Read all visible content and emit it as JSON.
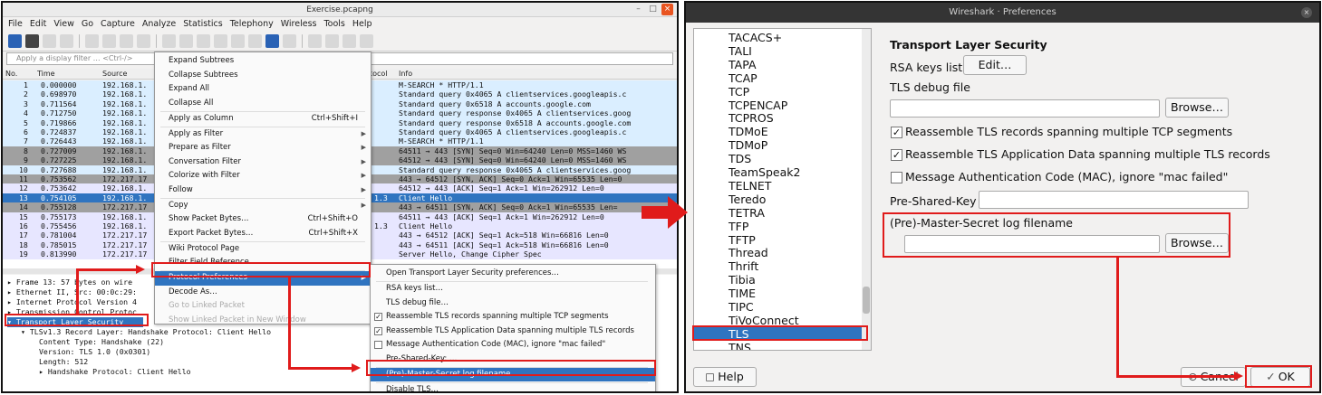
{
  "wireshark": {
    "title": "Exercise.pcapng",
    "menu": [
      "File",
      "Edit",
      "View",
      "Go",
      "Capture",
      "Analyze",
      "Statistics",
      "Telephony",
      "Wireless",
      "Tools",
      "Help"
    ],
    "filter_placeholder": "Apply a display filter … <Ctrl-/>",
    "columns": {
      "no": "No.",
      "time": "Time",
      "source": "Source",
      "protocol": "tocol",
      "info": "Info"
    },
    "packets": [
      {
        "no": "1",
        "time": "0.000000",
        "src": "192.168.1.",
        "proto": "",
        "info": "M-SEARCH * HTTP/1.1",
        "kind": "udp"
      },
      {
        "no": "2",
        "time": "0.698970",
        "src": "192.168.1.",
        "proto": "",
        "info": "Standard query 0x4065 A clientservices.googleapis.c",
        "kind": "udp"
      },
      {
        "no": "3",
        "time": "0.711564",
        "src": "192.168.1.",
        "proto": "",
        "info": "Standard query 0x6518 A accounts.google.com",
        "kind": "udp"
      },
      {
        "no": "4",
        "time": "0.712750",
        "src": "192.168.1.",
        "proto": "",
        "info": "Standard query response 0x4065 A clientservices.goog",
        "kind": "udp"
      },
      {
        "no": "5",
        "time": "0.719866",
        "src": "192.168.1.",
        "proto": "",
        "info": "Standard query response 0x6518 A accounts.google.com",
        "kind": "udp"
      },
      {
        "no": "6",
        "time": "0.724837",
        "src": "192.168.1.",
        "proto": "",
        "info": "Standard query 0x4065 A clientservices.googleapis.c",
        "kind": "udp"
      },
      {
        "no": "7",
        "time": "0.726443",
        "src": "192.168.1.",
        "proto": "",
        "info": "M-SEARCH * HTTP/1.1",
        "kind": "udp"
      },
      {
        "no": "8",
        "time": "0.727009",
        "src": "192.168.1.",
        "proto": "",
        "info": "64511 → 443 [SYN] Seq=0 Win=64240 Len=0 MSS=1460 WS",
        "kind": "syn"
      },
      {
        "no": "9",
        "time": "0.727225",
        "src": "192.168.1.",
        "proto": "",
        "info": "64512 → 443 [SYN] Seq=0 Win=64240 Len=0 MSS=1460 WS",
        "kind": "syn"
      },
      {
        "no": "10",
        "time": "0.727688",
        "src": "192.168.1.",
        "proto": "",
        "info": "Standard query response 0x4065 A clientservices.goog",
        "kind": "udp"
      },
      {
        "no": "11",
        "time": "0.753562",
        "src": "172.217.17",
        "proto": "",
        "info": "443 → 64512 [SYN, ACK] Seq=0 Ack=1 Win=65535 Len=0",
        "kind": "syn"
      },
      {
        "no": "12",
        "time": "0.753642",
        "src": "192.168.1.",
        "proto": "",
        "info": "64512 → 443 [ACK] Seq=1 Ack=1 Win=262912 Len=0",
        "kind": "tcp"
      },
      {
        "no": "13",
        "time": "0.754105",
        "src": "192.168.1.",
        "proto": "1.3",
        "info": "Client Hello",
        "kind": "sel"
      },
      {
        "no": "14",
        "time": "0.755128",
        "src": "172.217.17",
        "proto": "",
        "info": "443 → 64511 [SYN, ACK] Seq=0 Ack=1 Win=65535 Len=",
        "kind": "syn"
      },
      {
        "no": "15",
        "time": "0.755173",
        "src": "192.168.1.",
        "proto": "",
        "info": "64511 → 443 [ACK] Seq=1 Ack=1 Win=262912 Len=0",
        "kind": "tcp"
      },
      {
        "no": "16",
        "time": "0.755456",
        "src": "192.168.1.",
        "proto": "1.3",
        "info": "Client Hello",
        "kind": "tcp"
      },
      {
        "no": "17",
        "time": "0.781004",
        "src": "172.217.17",
        "proto": "",
        "info": "443 → 64512 [ACK] Seq=1 Ack=518 Win=66816 Len=0",
        "kind": "tcp"
      },
      {
        "no": "18",
        "time": "0.785015",
        "src": "172.217.17",
        "proto": "",
        "info": "443 → 64511 [ACK] Seq=1 Ack=518 Win=66816 Len=0",
        "kind": "tcp"
      },
      {
        "no": "19",
        "time": "0.813990",
        "src": "172.217.17",
        "proto": "",
        "info": "Server Hello, Change Cipher Spec",
        "kind": "tcp"
      }
    ],
    "details": [
      {
        "text": "▸ Frame 13: 57 bytes on wire",
        "indent": 0,
        "sel": false
      },
      {
        "text": "▸ Ethernet II, Src: 00:0c:29:",
        "indent": 0,
        "sel": false
      },
      {
        "text": "▸ Internet Protocol Version 4",
        "indent": 0,
        "sel": false
      },
      {
        "text": "▸ Transmission Control Protoc",
        "indent": 0,
        "sel": false
      },
      {
        "text": "▾ Transport Layer Security",
        "indent": 0,
        "sel": true
      },
      {
        "text": "▾ TLSv1.3 Record Layer: Handshake Protocol: Client Hello",
        "indent": 1,
        "sel": false
      },
      {
        "text": "Content Type: Handshake (22)",
        "indent": 2,
        "sel": false
      },
      {
        "text": "Version: TLS 1.0 (0x0301)",
        "indent": 2,
        "sel": false
      },
      {
        "text": "Length: 512",
        "indent": 2,
        "sel": false
      },
      {
        "text": "▸ Handshake Protocol: Client Hello",
        "indent": 2,
        "sel": false
      }
    ],
    "context_menu": [
      {
        "label": "Expand Subtrees",
        "shortcut": "",
        "arrow": false,
        "disabled": false,
        "hl": false
      },
      {
        "label": "Collapse Subtrees",
        "shortcut": "",
        "arrow": false,
        "disabled": false,
        "hl": false
      },
      {
        "label": "Expand All",
        "shortcut": "",
        "arrow": false,
        "disabled": false,
        "hl": false
      },
      {
        "label": "Collapse All",
        "shortcut": "",
        "arrow": false,
        "disabled": false,
        "hl": false
      },
      {
        "label": "Apply as Column",
        "shortcut": "Ctrl+Shift+I",
        "arrow": false,
        "disabled": false,
        "hl": false
      },
      {
        "label": "Apply as Filter",
        "shortcut": "",
        "arrow": true,
        "disabled": false,
        "hl": false
      },
      {
        "label": "Prepare as Filter",
        "shortcut": "",
        "arrow": true,
        "disabled": false,
        "hl": false
      },
      {
        "label": "Conversation Filter",
        "shortcut": "",
        "arrow": true,
        "disabled": false,
        "hl": false
      },
      {
        "label": "Colorize with Filter",
        "shortcut": "",
        "arrow": true,
        "disabled": false,
        "hl": false
      },
      {
        "label": "Follow",
        "shortcut": "",
        "arrow": true,
        "disabled": false,
        "hl": false
      },
      {
        "label": "Copy",
        "shortcut": "",
        "arrow": true,
        "disabled": false,
        "hl": false
      },
      {
        "label": "Show Packet Bytes…",
        "shortcut": "Ctrl+Shift+O",
        "arrow": false,
        "disabled": false,
        "hl": false
      },
      {
        "label": "Export Packet Bytes…",
        "shortcut": "Ctrl+Shift+X",
        "arrow": false,
        "disabled": false,
        "hl": false
      },
      {
        "label": "Wiki Protocol Page",
        "shortcut": "",
        "arrow": false,
        "disabled": false,
        "hl": false
      },
      {
        "label": "Filter Field Reference",
        "shortcut": "",
        "arrow": false,
        "disabled": false,
        "hl": false
      },
      {
        "label": "Protocol Preferences",
        "shortcut": "",
        "arrow": true,
        "disabled": false,
        "hl": true
      },
      {
        "label": "Decode As…",
        "shortcut": "",
        "arrow": false,
        "disabled": false,
        "hl": false
      },
      {
        "label": "Go to Linked Packet",
        "shortcut": "",
        "arrow": false,
        "disabled": true,
        "hl": false
      },
      {
        "label": "Show Linked Packet in New Window",
        "shortcut": "",
        "arrow": false,
        "disabled": true,
        "hl": false
      }
    ],
    "submenu": [
      {
        "label": "Open Transport Layer Security preferences…",
        "check": "none",
        "hl": false
      },
      {
        "label": "RSA keys list…",
        "check": "none",
        "hl": false
      },
      {
        "label": "TLS debug file…",
        "check": "none",
        "hl": false
      },
      {
        "label": "Reassemble TLS records spanning multiple TCP segments",
        "check": "on",
        "hl": false
      },
      {
        "label": "Reassemble TLS Application Data spanning multiple TLS records",
        "check": "on",
        "hl": false
      },
      {
        "label": "Message Authentication Code (MAC), ignore \"mac failed\"",
        "check": "off",
        "hl": false
      },
      {
        "label": "Pre-Shared-Key: …",
        "check": "none",
        "hl": false
      },
      {
        "label": "(Pre)-Master-Secret log filename…",
        "check": "none",
        "hl": true
      },
      {
        "label": "Disable TLS…",
        "check": "none",
        "hl": false
      }
    ]
  },
  "prefs": {
    "title": "Wireshark · Preferences",
    "protocols": [
      "TACACS+",
      "TALI",
      "TAPA",
      "TCAP",
      "TCP",
      "TCPENCAP",
      "TCPROS",
      "TDMoE",
      "TDMoP",
      "TDS",
      "TeamSpeak2",
      "TELNET",
      "Teredo",
      "TETRA",
      "TFP",
      "TFTP",
      "Thread",
      "Thrift",
      "Tibia",
      "TIME",
      "TIPC",
      "TiVoConnect",
      "TLS",
      "TNS"
    ],
    "selected_protocol": "TLS",
    "section_title": "Transport Layer Security",
    "rsa_label": "RSA keys list",
    "edit_button": "Edit…",
    "debug_label": "TLS debug file",
    "browse_label": "Browse…",
    "cb1": "Reassemble TLS records spanning multiple TCP segments",
    "cb2": "Reassemble TLS Application Data spanning multiple TLS records",
    "cb3": "Message Authentication Code (MAC), ignore \"mac failed\"",
    "cb1_checked": true,
    "cb2_checked": true,
    "cb3_checked": false,
    "psk_label": "Pre-Shared-Key",
    "master_label": "(Pre)-Master-Secret log filename",
    "help_button": "Help",
    "cancel_button": "Cancel",
    "ok_button": "OK"
  },
  "colors": {
    "selection": "#2f74c0",
    "annotation": "#e01b1b"
  }
}
